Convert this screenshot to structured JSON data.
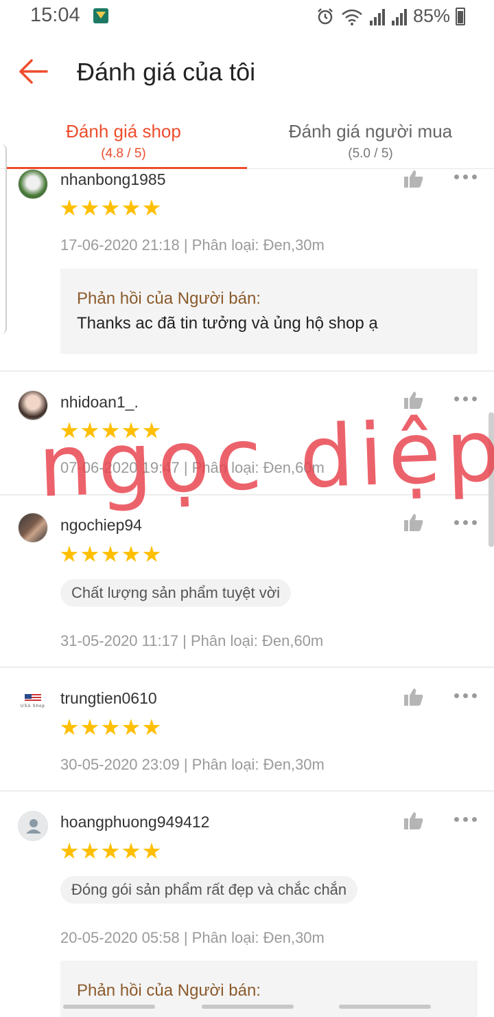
{
  "status_bar": {
    "time": "15:04",
    "battery_text": "85%",
    "icons": [
      "app-notification-icon",
      "alarm-icon",
      "wifi-icon",
      "signal-icon",
      "signal-icon",
      "battery-charging-icon"
    ]
  },
  "header": {
    "title": "Đánh giá của tôi",
    "back_icon": "arrow-left-icon"
  },
  "tabs": [
    {
      "label": "Đánh giá shop",
      "rating": "(4.8 / 5)",
      "active": true
    },
    {
      "label": "Đánh giá người mua",
      "rating": "(5.0 / 5)",
      "active": false
    }
  ],
  "reviews": [
    {
      "username": "nhanbong1985",
      "stars": 5,
      "meta": "17-06-2020 21:18 | Phân loại: Đen,30m",
      "reply": {
        "title": "Phản hồi của Người bán:",
        "text": "Thanks ac đã tin tưởng và ủng hộ shop ạ"
      }
    },
    {
      "username": "nhidoan1_.",
      "stars": 5,
      "meta": "07-06-2020 19:47 | Phân loại: Đen,60m"
    },
    {
      "username": "ngochiep94",
      "stars": 5,
      "tag": "Chất lượng sản phẩm tuyệt vời",
      "meta": "31-05-2020 11:17 | Phân loại: Đen,60m"
    },
    {
      "username": "trungtien0610",
      "stars": 5,
      "avatar_text": "USA Shop",
      "meta": "30-05-2020 23:09 | Phân loại: Đen,30m"
    },
    {
      "username": "hoangphuong949412",
      "stars": 5,
      "tag": "Đóng gói sản phẩm rất đẹp và chắc chắn",
      "meta": "20-05-2020 05:58 | Phân loại: Đen,30m",
      "reply": {
        "title": "Phản hồi của Người bán:"
      }
    }
  ],
  "watermark": "ngọc diệp",
  "colors": {
    "accent": "#ee4d2d",
    "star": "#ffbf00",
    "reply_title": "#8b5a2b",
    "watermark": "#e8404a"
  }
}
